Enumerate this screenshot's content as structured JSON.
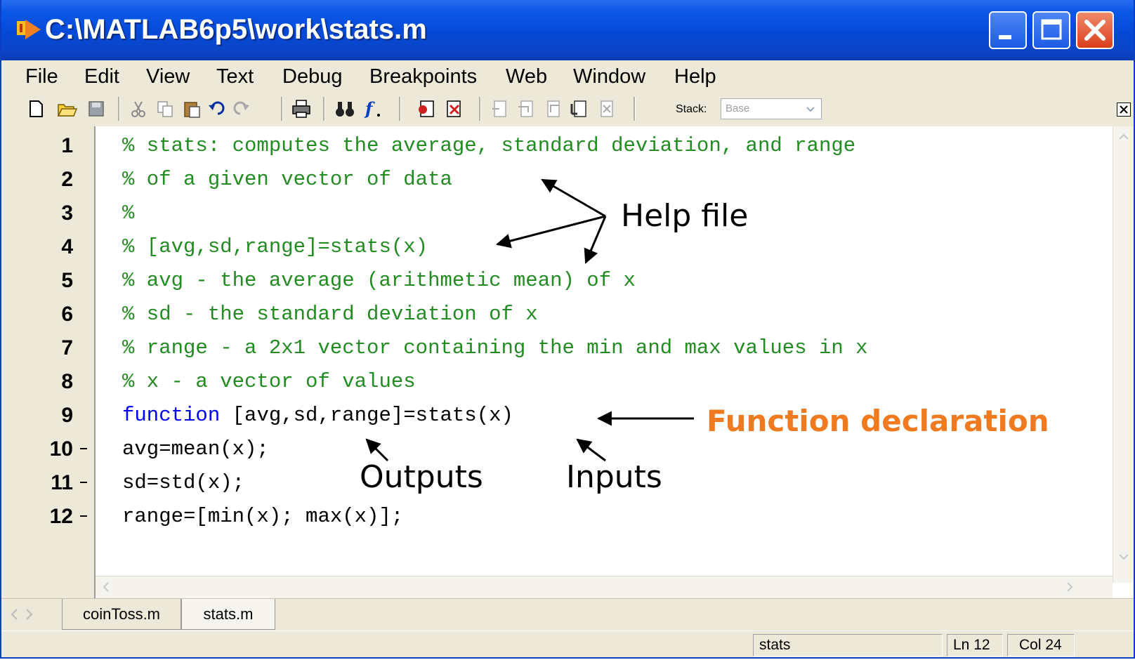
{
  "window": {
    "title": "C:\\MATLAB6p5\\work\\stats.m"
  },
  "menu": [
    "File",
    "Edit",
    "View",
    "Text",
    "Debug",
    "Breakpoints",
    "Web",
    "Window",
    "Help"
  ],
  "toolbar": {
    "stack_label": "Stack:",
    "stack_value": "Base"
  },
  "editor": {
    "line_numbers": [
      "1",
      "2",
      "3",
      "4",
      "5",
      "6",
      "7",
      "8",
      "9",
      "10",
      "11",
      "12"
    ],
    "lines": [
      {
        "type": "comment",
        "text": "% stats: computes the average, standard deviation, and range"
      },
      {
        "type": "comment",
        "text": "% of a given vector of data"
      },
      {
        "type": "comment",
        "text": "%"
      },
      {
        "type": "comment",
        "text": "% [avg,sd,range]=stats(x)"
      },
      {
        "type": "comment",
        "text": "% avg - the average (arithmetic mean) of x"
      },
      {
        "type": "comment",
        "text": "% sd - the standard deviation of x"
      },
      {
        "type": "comment",
        "text": "% range - a 2x1 vector containing the min and max values in x"
      },
      {
        "type": "comment",
        "text": "% x - a vector of values"
      },
      {
        "type": "function",
        "keyword": "function",
        "text": " [avg,sd,range]=stats(x)"
      },
      {
        "type": "code",
        "text": "avg=mean(x);"
      },
      {
        "type": "code",
        "text": "sd=std(x);"
      },
      {
        "type": "code",
        "text": "range=[min(x); max(x)];"
      }
    ]
  },
  "tabs": [
    "coinToss.m",
    "stats.m"
  ],
  "status": {
    "function_name": "stats",
    "line": "Ln 12",
    "col": "Col 24"
  },
  "annotations": {
    "help_file": "Help file",
    "function_declaration": "Function declaration",
    "outputs": "Outputs",
    "inputs": "Inputs"
  },
  "colors": {
    "comment": "#228b22",
    "keyword": "#0000ff",
    "annotation_highlight": "#f07a20",
    "titlebar": "#0a58e8"
  }
}
